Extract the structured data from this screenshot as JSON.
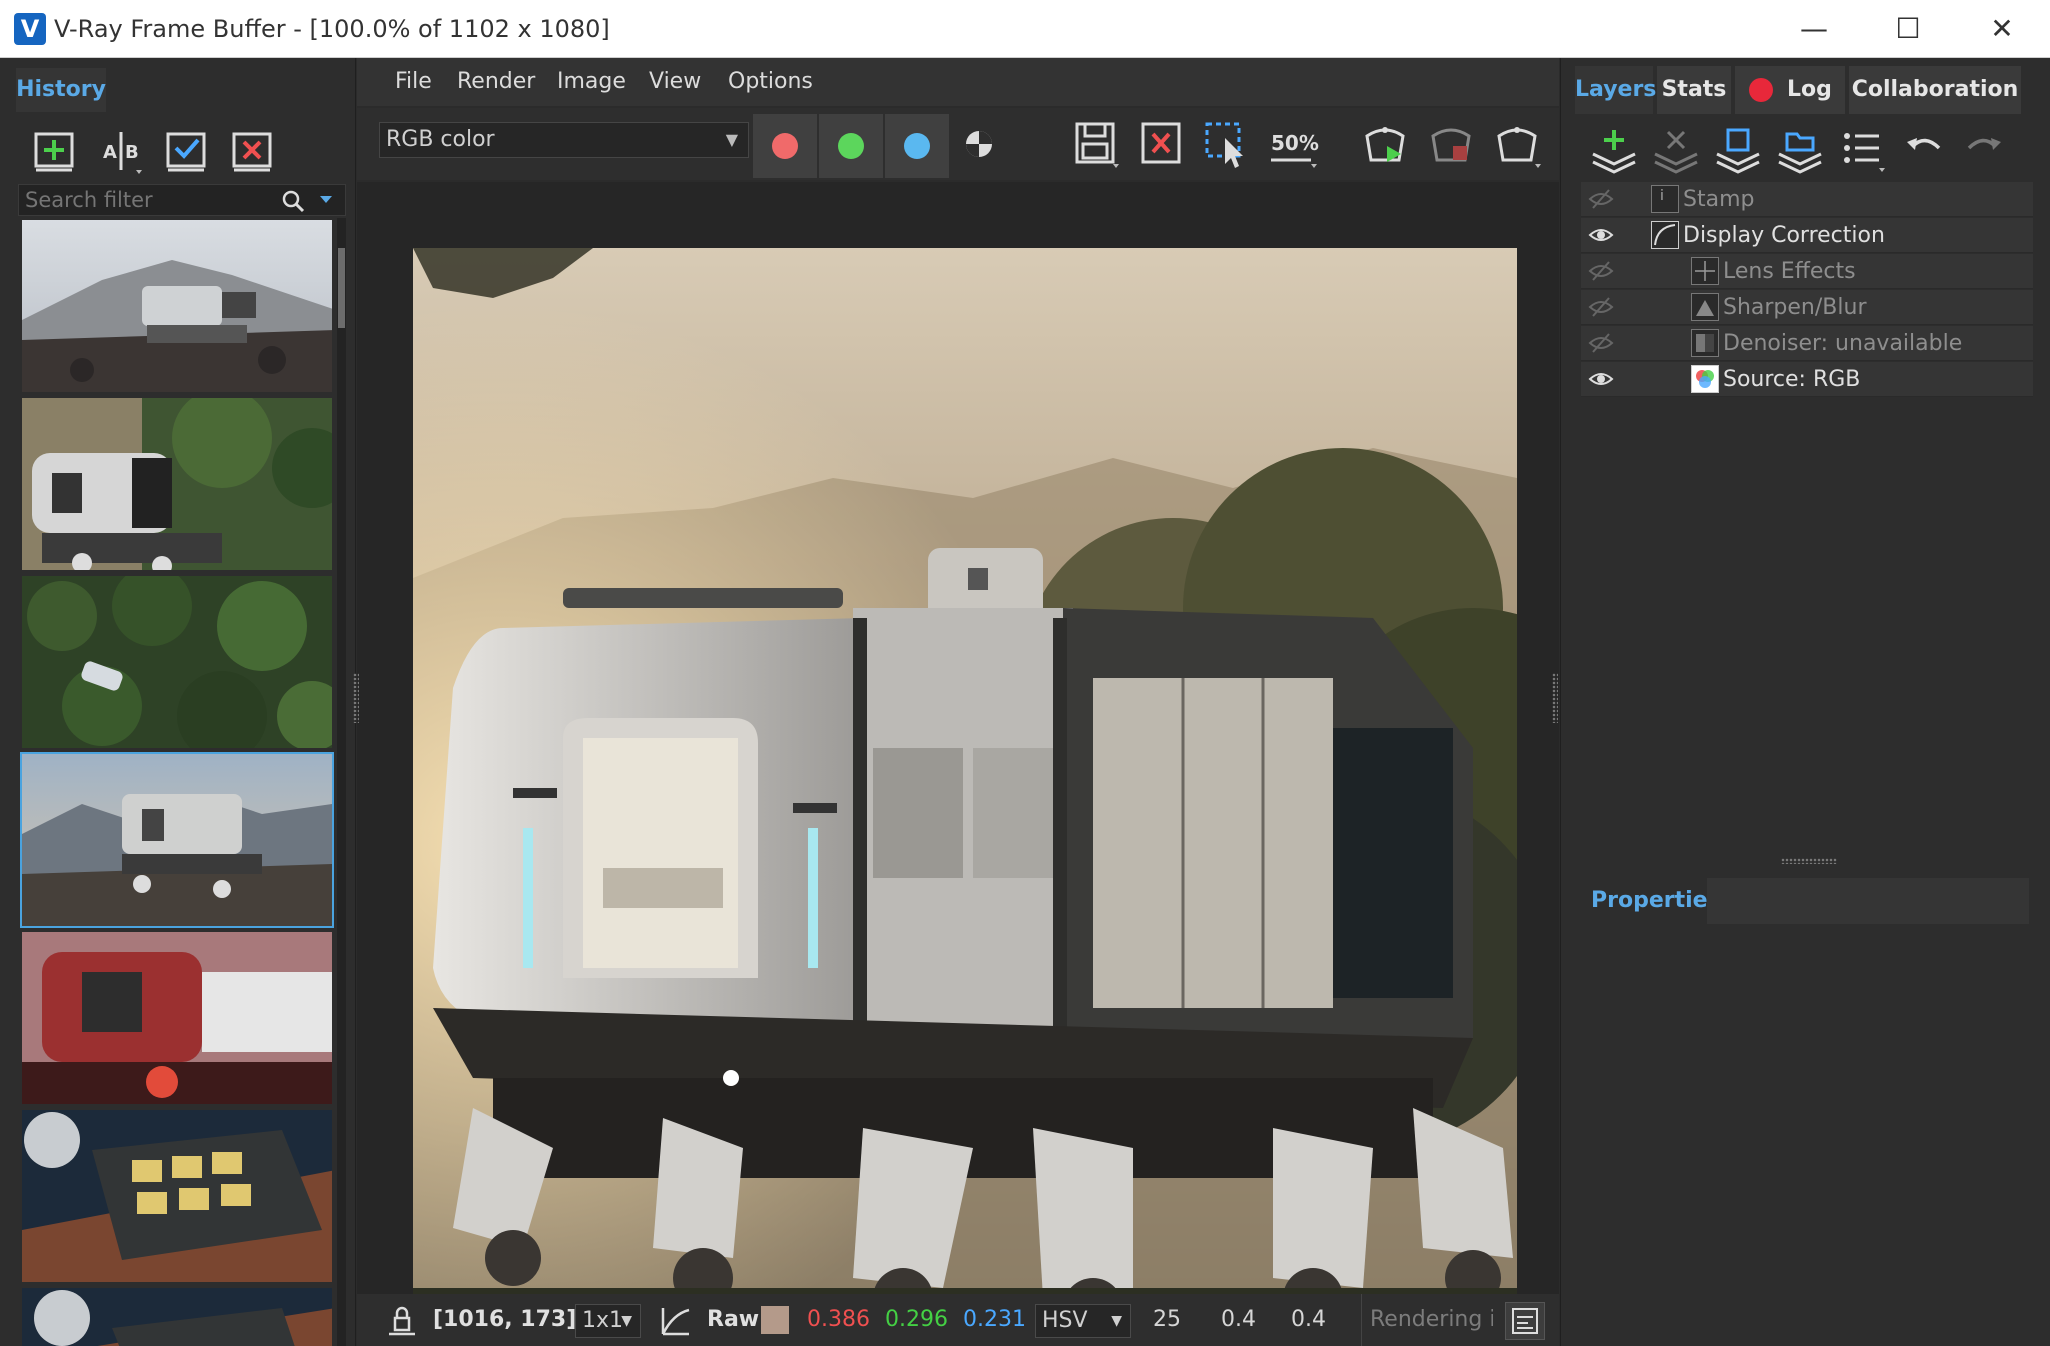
{
  "window": {
    "title": "V-Ray Frame Buffer - [100.0% of 1102 x 1080]",
    "app_icon": "vray-logo-icon",
    "controls": {
      "minimize": "—",
      "maximize": "☐",
      "close": "✕"
    }
  },
  "history": {
    "tab_label": "History",
    "tools": [
      "save-to-history-icon",
      "ab-compare-icon",
      "load-history-icon",
      "remove-history-icon"
    ],
    "search_placeholder": "Search filter",
    "thumbnails": [
      {
        "name": "render-desert-vehicle",
        "selected": false
      },
      {
        "name": "render-forest-vehicle",
        "selected": false
      },
      {
        "name": "render-aerial-forest",
        "selected": false
      },
      {
        "name": "render-mountain-vehicle",
        "selected": true
      },
      {
        "name": "render-red-mech",
        "selected": false
      },
      {
        "name": "render-solar-roof",
        "selected": false
      },
      {
        "name": "render-roof-partial",
        "selected": false
      }
    ]
  },
  "menu": {
    "items": [
      "File",
      "Render",
      "Image",
      "View",
      "Options"
    ]
  },
  "toolbar": {
    "channel": "RGB color",
    "channel_colors": {
      "red": "#f06a6a",
      "green": "#5cd65c",
      "blue": "#5ab8f0"
    },
    "zoom_badge": "50%"
  },
  "status": {
    "coords": "[1016, 173]",
    "ratio": "1x1",
    "mode": "Raw",
    "r": "0.386",
    "g": "0.296",
    "b": "0.231",
    "color_space": "HSV",
    "h": "25",
    "s": "0.4",
    "v": "0.4",
    "progress_text": "Rendering ir",
    "colors": {
      "r": "#f05050",
      "g": "#44d044",
      "b": "#4aa8ff",
      "swatch": "#b49a8a"
    }
  },
  "right_tabs": [
    "Layers",
    "Stats",
    "Log",
    "Collaboration"
  ],
  "layers": [
    {
      "name": "Stamp",
      "visible": false,
      "indent": 0,
      "icon": "stamp-icon"
    },
    {
      "name": "Display Correction",
      "visible": true,
      "indent": 0,
      "icon": "curve-icon"
    },
    {
      "name": "Lens Effects",
      "visible": false,
      "indent": 1,
      "icon": "lens-effects-icon"
    },
    {
      "name": "Sharpen/Blur",
      "visible": false,
      "indent": 1,
      "icon": "sharpen-icon"
    },
    {
      "name": "Denoiser: unavailable",
      "visible": false,
      "indent": 1,
      "icon": "denoiser-icon"
    },
    {
      "name": "Source: RGB",
      "visible": true,
      "indent": 1,
      "icon": "rgb-source-icon"
    }
  ],
  "properties_label": "Properties",
  "accent": "#5aa9e6"
}
